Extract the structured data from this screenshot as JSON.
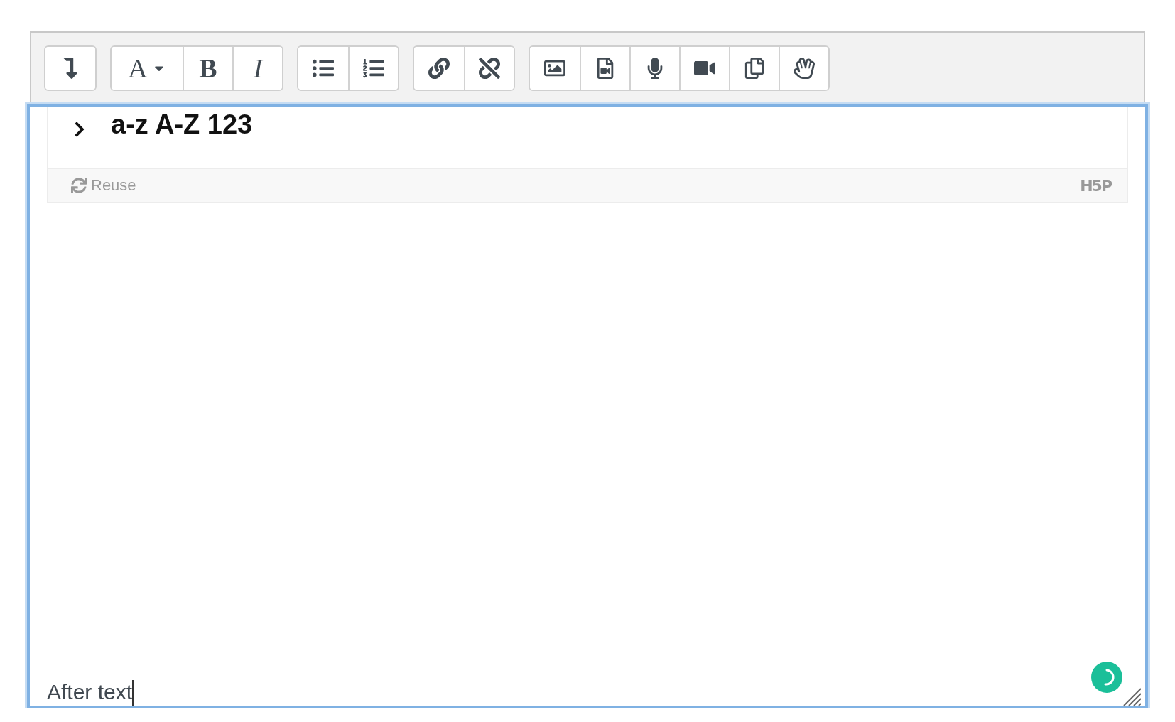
{
  "toolbar": {
    "groups": [
      {
        "buttons": [
          {
            "kind": "icon"
          }
        ]
      },
      {
        "buttons": [
          {
            "kind": "glyph",
            "label": "A",
            "dropdown": true
          },
          {
            "kind": "glyph",
            "label": "B"
          },
          {
            "kind": "glyph",
            "label": "I"
          }
        ]
      },
      {
        "buttons": [
          {
            "kind": "icon"
          },
          {
            "kind": "icon"
          }
        ]
      },
      {
        "buttons": [
          {
            "kind": "icon"
          },
          {
            "kind": "icon"
          }
        ]
      },
      {
        "buttons": [
          {
            "kind": "icon"
          },
          {
            "kind": "icon"
          },
          {
            "kind": "icon"
          },
          {
            "kind": "icon"
          },
          {
            "kind": "icon"
          },
          {
            "kind": "icon"
          }
        ]
      }
    ]
  },
  "editor": {
    "focused": true,
    "embed": {
      "title": "a-z A-Z 123",
      "action": "Reuse",
      "logo": "H5P"
    },
    "text": "After text"
  }
}
